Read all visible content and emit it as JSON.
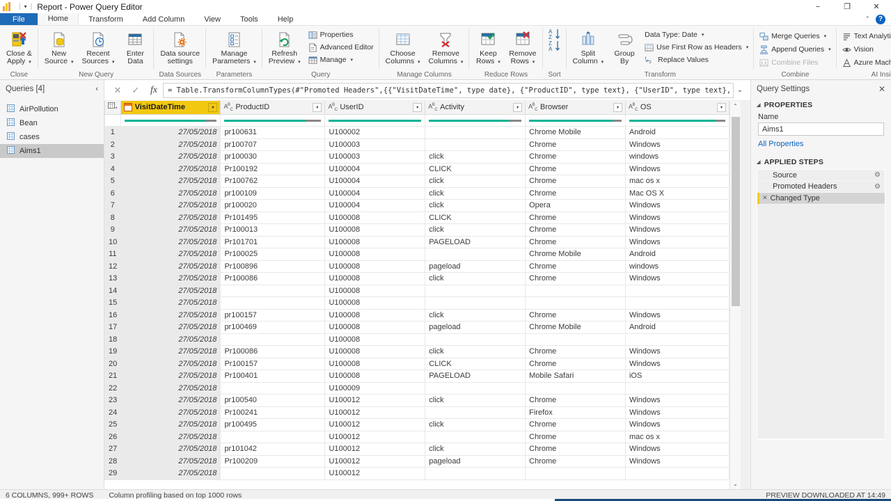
{
  "window": {
    "title": "Report - Power Query Editor",
    "quick_access_caret": "▾",
    "minimize": "−",
    "maximize": "❐",
    "close": "✕",
    "ribbon_collapse": "⌃",
    "help": "?"
  },
  "ribbon": {
    "tabs": [
      {
        "label": "File",
        "state": "file"
      },
      {
        "label": "Home",
        "state": "active"
      },
      {
        "label": "Transform",
        "state": "normal"
      },
      {
        "label": "Add Column",
        "state": "normal"
      },
      {
        "label": "View",
        "state": "normal"
      },
      {
        "label": "Tools",
        "state": "normal"
      },
      {
        "label": "Help",
        "state": "normal"
      }
    ],
    "groups": [
      {
        "name": "Close",
        "buttons": [
          {
            "label_line1": "Close &",
            "label_line2": "Apply",
            "icon": "close-and-apply-icon",
            "dropdown": true
          }
        ]
      },
      {
        "name": "New Query",
        "buttons": [
          {
            "label_line1": "New",
            "label_line2": "Source",
            "icon": "new-source-icon",
            "dropdown": true
          },
          {
            "label_line1": "Recent",
            "label_line2": "Sources",
            "icon": "recent-sources-icon",
            "dropdown": true
          },
          {
            "label_line1": "Enter",
            "label_line2": "Data",
            "icon": "enter-data-icon",
            "dropdown": false
          }
        ]
      },
      {
        "name": "Data Sources",
        "buttons": [
          {
            "label_line1": "Data source",
            "label_line2": "settings",
            "icon": "data-source-settings-icon",
            "dropdown": false
          }
        ]
      },
      {
        "name": "Parameters",
        "buttons": [
          {
            "label_line1": "Manage",
            "label_line2": "Parameters",
            "icon": "manage-parameters-icon",
            "dropdown": true
          }
        ]
      },
      {
        "name": "Query",
        "buttons": [
          {
            "label_line1": "Refresh",
            "label_line2": "Preview",
            "icon": "refresh-preview-icon",
            "dropdown": true
          }
        ],
        "small_buttons": [
          {
            "label": "Properties",
            "icon": "properties-icon",
            "dropdown": false
          },
          {
            "label": "Advanced Editor",
            "icon": "advanced-editor-icon",
            "dropdown": false
          },
          {
            "label": "Manage",
            "icon": "manage-icon",
            "dropdown": true
          }
        ]
      },
      {
        "name": "Manage Columns",
        "buttons": [
          {
            "label_line1": "Choose",
            "label_line2": "Columns",
            "icon": "choose-columns-icon",
            "dropdown": true
          },
          {
            "label_line1": "Remove",
            "label_line2": "Columns",
            "icon": "remove-columns-icon",
            "dropdown": true
          }
        ]
      },
      {
        "name": "Reduce Rows",
        "buttons": [
          {
            "label_line1": "Keep",
            "label_line2": "Rows",
            "icon": "keep-rows-icon",
            "dropdown": true
          },
          {
            "label_line1": "Remove",
            "label_line2": "Rows",
            "icon": "remove-rows-icon",
            "dropdown": true
          }
        ]
      },
      {
        "name": "Sort",
        "buttons": [
          {
            "label_line1": "",
            "label_line2": "",
            "icon": "sort-ascending-icon",
            "dropdown": false
          },
          {
            "label_line1": "",
            "label_line2": "",
            "icon": "sort-descending-icon",
            "dropdown": false
          }
        ]
      },
      {
        "name": "Transform",
        "buttons": [
          {
            "label_line1": "Split",
            "label_line2": "Column",
            "icon": "split-column-icon",
            "dropdown": true
          },
          {
            "label_line1": "Group",
            "label_line2": "By",
            "icon": "group-by-icon",
            "dropdown": false
          }
        ],
        "small_buttons": [
          {
            "label": "Data Type: Date",
            "icon": "data-type-icon",
            "dropdown": true
          },
          {
            "label": "Use First Row as Headers",
            "icon": "use-first-row-as-headers-icon",
            "dropdown": true
          },
          {
            "label": "Replace Values",
            "icon": "replace-values-icon",
            "dropdown": false
          }
        ]
      },
      {
        "name": "Combine",
        "small_buttons": [
          {
            "label": "Merge Queries",
            "icon": "merge-queries-icon",
            "dropdown": true
          },
          {
            "label": "Append Queries",
            "icon": "append-queries-icon",
            "dropdown": true
          },
          {
            "label": "Combine Files",
            "icon": "combine-files-icon",
            "dropdown": false,
            "disabled": true
          }
        ]
      },
      {
        "name": "AI Insights",
        "small_buttons": [
          {
            "label": "Text Analytics",
            "icon": "text-analytics-icon",
            "dropdown": false
          },
          {
            "label": "Vision",
            "icon": "vision-icon",
            "dropdown": false
          },
          {
            "label": "Azure Machine Learning",
            "icon": "azure-machine-learning-icon",
            "dropdown": false
          }
        ]
      }
    ]
  },
  "queries_pane": {
    "title": "Queries [4]",
    "collapse_icon": "‹",
    "items": [
      {
        "label": "AirPollution",
        "selected": false
      },
      {
        "label": "Bean",
        "selected": false
      },
      {
        "label": "cases",
        "selected": false
      },
      {
        "label": "Aims1",
        "selected": true
      }
    ]
  },
  "formula_bar": {
    "cancel_icon": "✕",
    "accept_icon": "✓",
    "fx_label": "fx",
    "formula": "= Table.TransformColumnTypes(#\"Promoted Headers\",{{\"VisitDateTime\", type date}, {\"ProductID\", type text}, {\"UserID\", type text}, {\"Activity\",",
    "expand_icon": "⌄"
  },
  "grid": {
    "select_all_icon": "grid-select-all-icon",
    "columns": [
      {
        "name": "VisitDateTime",
        "type_icon": "date-type-icon",
        "is_key": true,
        "quality": {
          "valid": 88,
          "error": 0,
          "empty": 12
        }
      },
      {
        "name": "ProductID",
        "type_icon": "text-type-icon",
        "is_key": false,
        "quality": {
          "valid": 84,
          "error": 0,
          "empty": 16
        }
      },
      {
        "name": "UserID",
        "type_icon": "text-type-icon",
        "is_key": false,
        "quality": {
          "valid": 100,
          "error": 0,
          "empty": 0
        }
      },
      {
        "name": "Activity",
        "type_icon": "text-type-icon",
        "is_key": false,
        "quality": {
          "valid": 86,
          "error": 0,
          "empty": 14
        }
      },
      {
        "name": "Browser",
        "type_icon": "text-type-icon",
        "is_key": false,
        "quality": {
          "valid": 90,
          "error": 0,
          "empty": 10
        }
      },
      {
        "name": "OS",
        "type_icon": "text-type-icon",
        "is_key": false,
        "quality": {
          "valid": 90,
          "error": 0,
          "empty": 10
        }
      }
    ],
    "rows": [
      {
        "n": "1",
        "VisitDateTime": "27/05/2018",
        "ProductID": "pr100631",
        "UserID": "U100002",
        "Activity": "",
        "Browser": "Chrome Mobile",
        "OS": "Android"
      },
      {
        "n": "2",
        "VisitDateTime": "27/05/2018",
        "ProductID": "pr100707",
        "UserID": "U100003",
        "Activity": "",
        "Browser": "Chrome",
        "OS": "Windows"
      },
      {
        "n": "3",
        "VisitDateTime": "27/05/2018",
        "ProductID": "pr100030",
        "UserID": "U100003",
        "Activity": "click",
        "Browser": "Chrome",
        "OS": "windows"
      },
      {
        "n": "4",
        "VisitDateTime": "27/05/2018",
        "ProductID": "Pr100192",
        "UserID": "U100004",
        "Activity": "CLICK",
        "Browser": "Chrome",
        "OS": "Windows"
      },
      {
        "n": "5",
        "VisitDateTime": "27/05/2018",
        "ProductID": "Pr100762",
        "UserID": "U100004",
        "Activity": "click",
        "Browser": "Chrome",
        "OS": "mac os x"
      },
      {
        "n": "6",
        "VisitDateTime": "27/05/2018",
        "ProductID": "pr100109",
        "UserID": "U100004",
        "Activity": "click",
        "Browser": "Chrome",
        "OS": "Mac OS X"
      },
      {
        "n": "7",
        "VisitDateTime": "27/05/2018",
        "ProductID": "pr100020",
        "UserID": "U100004",
        "Activity": "click",
        "Browser": "Opera",
        "OS": "Windows"
      },
      {
        "n": "8",
        "VisitDateTime": "27/05/2018",
        "ProductID": "Pr101495",
        "UserID": "U100008",
        "Activity": "CLICK",
        "Browser": "Chrome",
        "OS": "Windows"
      },
      {
        "n": "9",
        "VisitDateTime": "27/05/2018",
        "ProductID": "Pr100013",
        "UserID": "U100008",
        "Activity": "click",
        "Browser": "Chrome",
        "OS": "Windows"
      },
      {
        "n": "10",
        "VisitDateTime": "27/05/2018",
        "ProductID": "Pr101701",
        "UserID": "U100008",
        "Activity": "PAGELOAD",
        "Browser": "Chrome",
        "OS": "Windows"
      },
      {
        "n": "11",
        "VisitDateTime": "27/05/2018",
        "ProductID": "Pr100025",
        "UserID": "U100008",
        "Activity": "",
        "Browser": "Chrome Mobile",
        "OS": "Android"
      },
      {
        "n": "12",
        "VisitDateTime": "27/05/2018",
        "ProductID": "Pr100896",
        "UserID": "U100008",
        "Activity": "pageload",
        "Browser": "Chrome",
        "OS": "windows"
      },
      {
        "n": "13",
        "VisitDateTime": "27/05/2018",
        "ProductID": "Pr100086",
        "UserID": "U100008",
        "Activity": "click",
        "Browser": "Chrome",
        "OS": "Windows"
      },
      {
        "n": "14",
        "VisitDateTime": "27/05/2018",
        "ProductID": "",
        "UserID": "U100008",
        "Activity": "",
        "Browser": "",
        "OS": ""
      },
      {
        "n": "15",
        "VisitDateTime": "27/05/2018",
        "ProductID": "",
        "UserID": "U100008",
        "Activity": "",
        "Browser": "",
        "OS": ""
      },
      {
        "n": "16",
        "VisitDateTime": "27/05/2018",
        "ProductID": "pr100157",
        "UserID": "U100008",
        "Activity": "click",
        "Browser": "Chrome",
        "OS": "Windows"
      },
      {
        "n": "17",
        "VisitDateTime": "27/05/2018",
        "ProductID": "pr100469",
        "UserID": "U100008",
        "Activity": "pageload",
        "Browser": "Chrome Mobile",
        "OS": "Android"
      },
      {
        "n": "18",
        "VisitDateTime": "27/05/2018",
        "ProductID": "",
        "UserID": "U100008",
        "Activity": "",
        "Browser": "",
        "OS": ""
      },
      {
        "n": "19",
        "VisitDateTime": "27/05/2018",
        "ProductID": "Pr100086",
        "UserID": "U100008",
        "Activity": "click",
        "Browser": "Chrome",
        "OS": "Windows"
      },
      {
        "n": "20",
        "VisitDateTime": "27/05/2018",
        "ProductID": "Pr100157",
        "UserID": "U100008",
        "Activity": "CLICK",
        "Browser": "Chrome",
        "OS": "Windows"
      },
      {
        "n": "21",
        "VisitDateTime": "27/05/2018",
        "ProductID": "Pr100401",
        "UserID": "U100008",
        "Activity": "PAGELOAD",
        "Browser": "Mobile Safari",
        "OS": "iOS"
      },
      {
        "n": "22",
        "VisitDateTime": "27/05/2018",
        "ProductID": "",
        "UserID": "U100009",
        "Activity": "",
        "Browser": "",
        "OS": ""
      },
      {
        "n": "23",
        "VisitDateTime": "27/05/2018",
        "ProductID": "pr100540",
        "UserID": "U100012",
        "Activity": "click",
        "Browser": "Chrome",
        "OS": "Windows"
      },
      {
        "n": "24",
        "VisitDateTime": "27/05/2018",
        "ProductID": "Pr100241",
        "UserID": "U100012",
        "Activity": "",
        "Browser": "Firefox",
        "OS": "Windows"
      },
      {
        "n": "25",
        "VisitDateTime": "27/05/2018",
        "ProductID": "pr100495",
        "UserID": "U100012",
        "Activity": "click",
        "Browser": "Chrome",
        "OS": "Windows"
      },
      {
        "n": "26",
        "VisitDateTime": "27/05/2018",
        "ProductID": "",
        "UserID": "U100012",
        "Activity": "",
        "Browser": "Chrome",
        "OS": "mac os x"
      },
      {
        "n": "27",
        "VisitDateTime": "27/05/2018",
        "ProductID": "pr101042",
        "UserID": "U100012",
        "Activity": "click",
        "Browser": "Chrome",
        "OS": "Windows"
      },
      {
        "n": "28",
        "VisitDateTime": "27/05/2018",
        "ProductID": "Pr100209",
        "UserID": "U100012",
        "Activity": "pageload",
        "Browser": "Chrome",
        "OS": "Windows"
      },
      {
        "n": "29",
        "VisitDateTime": "27/05/2018",
        "ProductID": "",
        "UserID": "U100012",
        "Activity": "",
        "Browser": "",
        "OS": ""
      }
    ],
    "scroll_up_icon": "⌃",
    "scroll_down_icon": "⌄"
  },
  "query_settings": {
    "title": "Query Settings",
    "close_icon": "✕",
    "properties_section": "PROPERTIES",
    "name_label": "Name",
    "name_value": "Aims1",
    "all_properties_link": "All Properties",
    "applied_steps_section": "APPLIED STEPS",
    "steps": [
      {
        "label": "Source",
        "gear": true,
        "selected": false,
        "deletable": false
      },
      {
        "label": "Promoted Headers",
        "gear": true,
        "selected": false,
        "deletable": false
      },
      {
        "label": "Changed Type",
        "gear": false,
        "selected": true,
        "deletable": true
      }
    ]
  },
  "status_bar": {
    "columns_rows": "6 COLUMNS, 999+ ROWS",
    "profiling": "Column profiling based on top 1000 rows",
    "preview": "PREVIEW DOWNLOADED AT 14:49"
  },
  "colors": {
    "accent_yellow": "#F2C811",
    "quality_green": "#00B294",
    "quality_grey": "#8a8886",
    "file_tab_blue": "#1e6bb8",
    "link_blue": "#0c64c0"
  }
}
